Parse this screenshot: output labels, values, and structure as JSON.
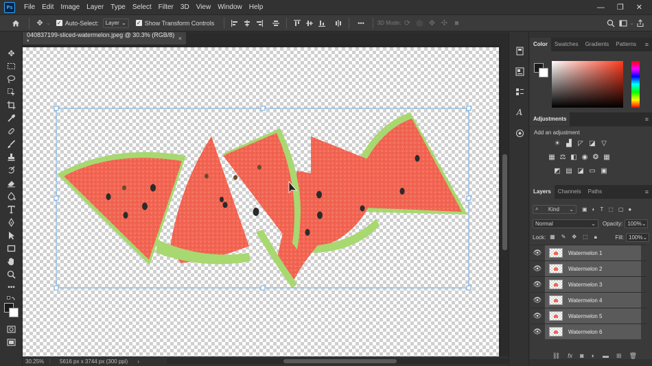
{
  "menubar": {
    "logo": "Ps",
    "items": [
      "File",
      "Edit",
      "Image",
      "Layer",
      "Type",
      "Select",
      "Filter",
      "3D",
      "View",
      "Window",
      "Help"
    ],
    "window_controls": [
      "—",
      "❐",
      "✕"
    ]
  },
  "options": {
    "auto_select_label": "Auto-Select:",
    "auto_select_target": "Layer",
    "show_transform_label": "Show Transform Controls",
    "mode_3d_label": "3D Mode:",
    "more": "•••"
  },
  "document": {
    "tab_title": "040837199-sliced-watermelon.jpeg @ 30.3% (RGB/8) *",
    "close": "×"
  },
  "status": {
    "zoom": "30.25%",
    "info": "5616 px x 3744 px (300 ppi)",
    "arrow": "›"
  },
  "panels": {
    "color_tabs": [
      "Color",
      "Swatches",
      "Gradients",
      "Patterns"
    ],
    "adjustments_tab": "Adjustments",
    "adjustments_hint": "Add an adjustment",
    "layers_tabs": [
      "Layers",
      "Channels",
      "Paths"
    ],
    "kind_label": "Kind",
    "blend_mode": "Normal",
    "opacity_label": "Opacity:",
    "opacity_value": "100%",
    "lock_label": "Lock:",
    "fill_label": "Fill:",
    "fill_value": "100%",
    "menu": "≡"
  },
  "layers": [
    {
      "name": "Watermelon 1"
    },
    {
      "name": "Watermelon 2"
    },
    {
      "name": "Watermelon 3"
    },
    {
      "name": "Watermelon 4"
    },
    {
      "name": "Watermelon 5"
    },
    {
      "name": "Watermelon 6"
    }
  ],
  "colors": {
    "accent": "#31a8ff",
    "flesh": "#f26552",
    "rind": "#9fd36b",
    "selection_box": "#6fa8dc"
  }
}
